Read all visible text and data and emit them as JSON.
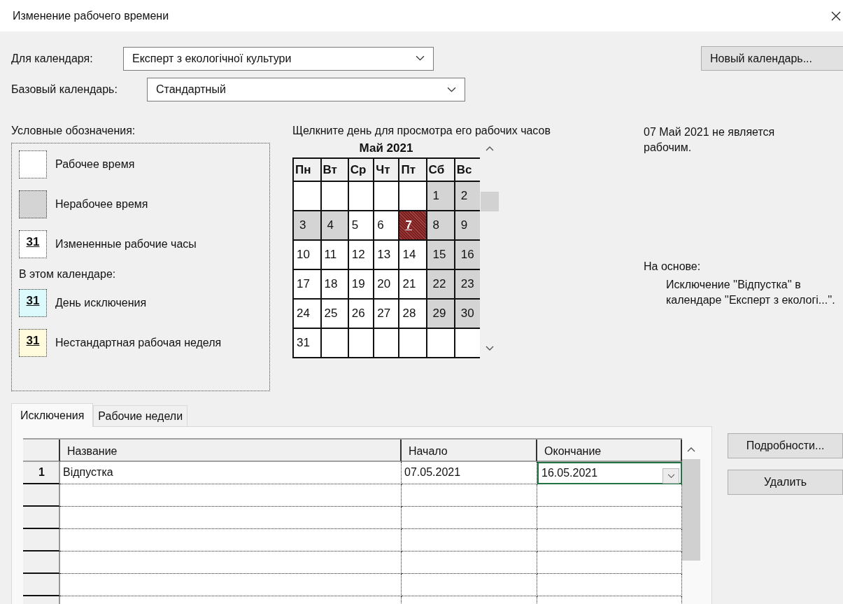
{
  "window": {
    "title": "Изменение рабочего времени"
  },
  "for_calendar": {
    "label": "Для календаря:",
    "value": "Експерт з екологічної культури"
  },
  "new_calendar_button": "Новый календарь...",
  "base_calendar": {
    "label": "Базовый календарь:",
    "value": "Стандартный"
  },
  "legend": {
    "title": "Условные обозначения:",
    "items": [
      {
        "kind": "swatch",
        "label": "Рабочее время",
        "color": "#ffffff"
      },
      {
        "kind": "swatch",
        "label": "Нерабочее время",
        "color": "#d4d4d4"
      },
      {
        "kind": "swatch",
        "label": "Измененные рабочие часы",
        "color": "#ffffff",
        "sample": "31"
      },
      {
        "kind": "heading",
        "label": "В этом календаре:"
      },
      {
        "kind": "swatch",
        "label": "День исключения",
        "color": "#dcfafc",
        "sample": "31"
      },
      {
        "kind": "swatch",
        "label": "Нестандартная рабочая неделя",
        "color": "#fffbdc",
        "sample": "31"
      }
    ]
  },
  "calendar": {
    "instruction": "Щелкните день для просмотра его рабочих часов",
    "month": "Май 2021",
    "weekdays": [
      "Пн",
      "Вт",
      "Ср",
      "Чт",
      "Пт",
      "Сб",
      "Вс"
    ],
    "weeks": [
      [
        {
          "nonworking": false,
          "selected": false
        },
        {
          "nonworking": false,
          "selected": false
        },
        {
          "nonworking": false,
          "selected": false
        },
        {
          "nonworking": false,
          "selected": false
        },
        {
          "nonworking": false,
          "selected": false
        },
        {
          "day": "1",
          "nonworking": true,
          "selected": false
        },
        {
          "day": "2",
          "nonworking": true,
          "selected": false
        }
      ],
      [
        {
          "day": "3",
          "nonworking": true,
          "selected": false
        },
        {
          "day": "4",
          "nonworking": true,
          "selected": false
        },
        {
          "day": "5",
          "nonworking": false,
          "selected": false
        },
        {
          "day": "6",
          "nonworking": false,
          "selected": false
        },
        {
          "day": "7",
          "nonworking": true,
          "selected": true
        },
        {
          "day": "8",
          "nonworking": true,
          "selected": false
        },
        {
          "day": "9",
          "nonworking": true,
          "selected": false
        }
      ],
      [
        {
          "day": "10",
          "nonworking": false,
          "selected": false
        },
        {
          "day": "11",
          "nonworking": false,
          "selected": false
        },
        {
          "day": "12",
          "nonworking": false,
          "selected": false
        },
        {
          "day": "13",
          "nonworking": false,
          "selected": false
        },
        {
          "day": "14",
          "nonworking": false,
          "selected": false
        },
        {
          "day": "15",
          "nonworking": true,
          "selected": false
        },
        {
          "day": "16",
          "nonworking": true,
          "selected": false
        }
      ],
      [
        {
          "day": "17",
          "nonworking": false,
          "selected": false
        },
        {
          "day": "18",
          "nonworking": false,
          "selected": false
        },
        {
          "day": "19",
          "nonworking": false,
          "selected": false
        },
        {
          "day": "20",
          "nonworking": false,
          "selected": false
        },
        {
          "day": "21",
          "nonworking": false,
          "selected": false
        },
        {
          "day": "22",
          "nonworking": true,
          "selected": false
        },
        {
          "day": "23",
          "nonworking": true,
          "selected": false
        }
      ],
      [
        {
          "day": "24",
          "nonworking": false,
          "selected": false
        },
        {
          "day": "25",
          "nonworking": false,
          "selected": false
        },
        {
          "day": "26",
          "nonworking": false,
          "selected": false
        },
        {
          "day": "27",
          "nonworking": false,
          "selected": false
        },
        {
          "day": "28",
          "nonworking": false,
          "selected": false
        },
        {
          "day": "29",
          "nonworking": true,
          "selected": false
        },
        {
          "day": "30",
          "nonworking": true,
          "selected": false
        }
      ],
      [
        {
          "day": "31",
          "nonworking": false,
          "selected": false
        },
        {
          "nonworking": false,
          "selected": false
        },
        {
          "nonworking": false,
          "selected": false
        },
        {
          "nonworking": false,
          "selected": false
        },
        {
          "nonworking": false,
          "selected": false
        },
        {
          "nonworking": false,
          "selected": false
        },
        {
          "nonworking": false,
          "selected": false
        }
      ]
    ]
  },
  "info": {
    "status": "07 Май 2021 не является рабочим.",
    "based_on_label": "На основе:",
    "based_on_text": "Исключение ''Відпустка'' в календаре ''Експерт з екологі...''."
  },
  "tabs": [
    {
      "label": "Исключения",
      "selected": true
    },
    {
      "label": "Рабочие недели",
      "selected": false
    }
  ],
  "table": {
    "columns": [
      "Название",
      "Начало",
      "Окончание"
    ],
    "rows": [
      {
        "number": "1",
        "cells": [
          {
            "text": "Відпустка",
            "selected": false
          },
          {
            "text": "07.05.2021",
            "selected": false
          },
          {
            "text": "16.05.2021",
            "selected": true
          }
        ]
      }
    ]
  },
  "buttons": [
    "Подробности...",
    "Удалить"
  ]
}
